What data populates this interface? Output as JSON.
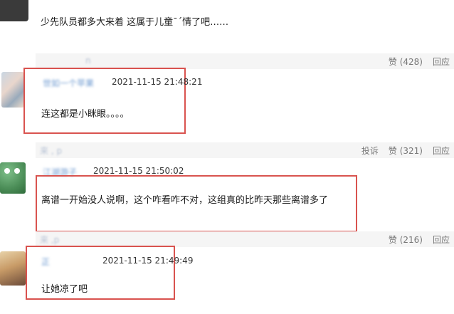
{
  "comments": [
    {
      "text": "少先队员都多大来着 这属于儿童¯´情了吧……",
      "reply_meta_blur": "n",
      "actions": {
        "like": "赞 (428)",
        "reply": "回应"
      }
    },
    {
      "username_blur": "世如一个苹果",
      "time": "2021-11-15 21:48:21",
      "text": "连这都是小眯眼。。。。",
      "reply_meta_blur": "来   , p",
      "actions": {
        "report": "投诉",
        "like": "赞 (321)",
        "reply": "回应"
      }
    },
    {
      "username_blur": "江湖游子",
      "time": "2021-11-15 21:50:02",
      "text": "离谱一开始没人说啊，这个咋看咋不对，这组真的比昨天那些离谱多了",
      "reply_meta_blur": "来     ,p",
      "actions": {
        "like": "赞 (216)",
        "reply": "回应"
      }
    },
    {
      "username_blur": "正        ",
      "time": "2021-11-15 21:49:49",
      "text": "让她凉了吧"
    }
  ],
  "colors": {
    "highlight_border": "#d9534f",
    "action_bar": "#f5f5f5",
    "username": "#6f9bd1"
  }
}
